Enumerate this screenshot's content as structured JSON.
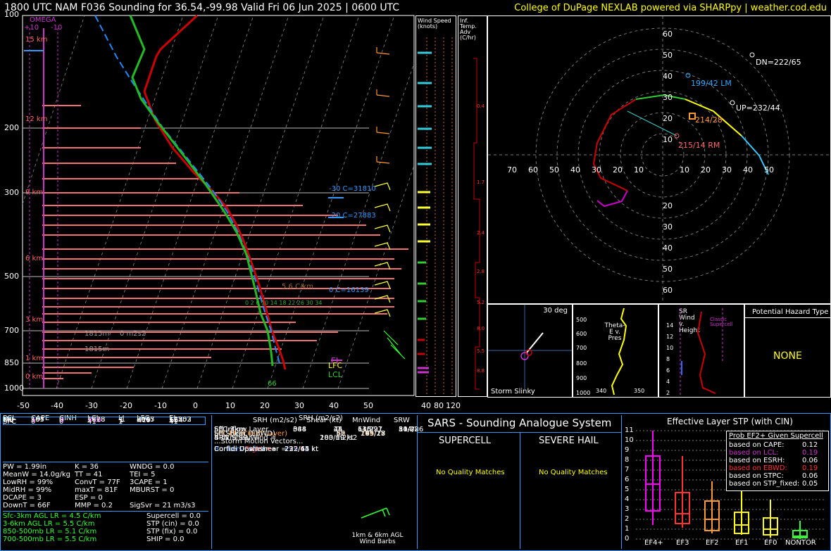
{
  "header": {
    "title": "1800 UTC NAM F036 Sounding for 36.54,-99.98 Valid  Fri 06 Jun 2025 | 0600 UTC",
    "credit": "College of DuPage NEXLAB powered via SHARPpy | weather.cod.edu"
  },
  "skewt": {
    "pressure_labels": [
      "100",
      "200",
      "300",
      "500",
      "700",
      "850",
      "1000"
    ],
    "temp_labels": [
      "-50",
      "-40",
      "-30",
      "-20",
      "-10",
      "0",
      "10",
      "20",
      "30",
      "40",
      "50"
    ],
    "height_labels": [
      "15 km",
      "12 km",
      "9 km",
      "6 km",
      "3 km",
      "1 km",
      "0 km"
    ],
    "omega_title": "OMEGA",
    "omega_left": "+10",
    "omega_right": "-10",
    "isotherm_labels": [
      "-30 C=31810",
      "-20 C=27883",
      "0 C=16139"
    ],
    "lapse_label": "5.6 C/km",
    "pw_scale": "0 2 6 10   14  18 22 26 30 34",
    "dcape_a": "1815m",
    "dcape_b": "0 m2s2",
    "dcape_c": "1815m",
    "parcel_labels": {
      "el": "EL",
      "lfc": "LFC",
      "lcl": "LCL"
    },
    "sfc_theta": "66",
    "colors": {
      "temp": "#cc0000",
      "dew": "#22aa22",
      "wetbulb": "#2288ff",
      "virtual": "#cc0000"
    }
  },
  "wind_panel": {
    "title": "Wind Speed (knots)",
    "scale": [
      "40",
      "80",
      "120"
    ]
  },
  "infl_panel": {
    "title": "Inf. Temp. Adv (C/hr)",
    "values": [
      "0.4",
      "1.7",
      "2.4",
      "2.8",
      "5.2",
      "8.0",
      "5.5",
      "8.8"
    ]
  },
  "hodograph": {
    "ring_labels_top": [
      "60",
      "50",
      "40",
      "30",
      "20",
      "10"
    ],
    "ring_labels_bottom": [
      "20",
      "30",
      "40",
      "50",
      "60"
    ],
    "x_left": [
      "70",
      "60",
      "50",
      "40",
      "30",
      "20",
      "10"
    ],
    "x_right": [
      "10",
      "20",
      "30",
      "40",
      "50"
    ],
    "annot": {
      "dn": "DN=222/65",
      "lm": "199/42 LM",
      "up": "UP=232/44",
      "mean": "214/28",
      "rm": "215/14 RM"
    }
  },
  "storm_slinky": {
    "title": "Storm Slinky",
    "deg": "30 deg"
  },
  "theta_panel": {
    "levels": [
      "500",
      "600",
      "700",
      "800",
      "900",
      "1000"
    ],
    "label": "Theta-E v. Pres",
    "x1": "340",
    "x2": "350"
  },
  "srwind_panel": {
    "title": "SR Wind v. Height",
    "levels": [
      "14",
      "12",
      "10",
      "8",
      "6",
      "4",
      "2"
    ],
    "note": "Classic Supercell"
  },
  "hazard": {
    "title": "Potential Hazard Type",
    "value": "NONE"
  },
  "parcel_table": {
    "headers": [
      "PCL",
      "CAPE",
      "CINH",
      "LCL",
      "LI",
      "LFC",
      "EL"
    ],
    "rows": [
      [
        "SFC",
        "0",
        "0",
        "41",
        "1",
        "--",
        "41"
      ],
      [
        "EFF",
        "197",
        "0",
        "1818",
        "-1",
        "8615",
        "12553"
      ],
      [
        "ML",
        "1",
        "0",
        "419",
        "1",
        "419",
        "654"
      ],
      [
        "MU",
        "165",
        "0",
        "1828",
        "-1",
        "8967",
        "12202"
      ]
    ]
  },
  "indices": {
    "col1": [
      "PW = 1.99in",
      "MeanW = 14.0g/kg",
      "LowRH = 99%",
      "MidRH = 99%",
      "DCAPE = 3",
      "DownT = 66F"
    ],
    "col2": [
      "K = 36",
      "TT = 41",
      "ConvT = 77F",
      "maxT = 81F",
      "ESP = 0",
      "MMP = 0.2"
    ],
    "col3": [
      "WNDG = 0.0",
      "TEI = 5",
      "3CAPE = 1",
      "MBURST = 0",
      "",
      "SigSvr = 21 m3/s3"
    ]
  },
  "lapse": {
    "lines": [
      "Sfc-3km AGL LR = 4.5 C/km",
      "3-6km AGL LR = 5.5 C/km",
      "850-500mb LR = 5.1 C/km",
      "700-500mb LR = 5.5 C/km"
    ],
    "comp": [
      "Supercell = 0.0",
      "STP (cin) = 0.0",
      "STP (fix) = 0.0",
      "SHIP = 0.0"
    ]
  },
  "kin_table": {
    "headers": [
      "SRH (m2/s2)",
      "Shear (kt)",
      "MnWind",
      "SRW"
    ],
    "rows": [
      [
        "SFC-1km",
        "344",
        "24",
        "63/29",
        "54/42"
      ],
      [
        "SFC-3km",
        "588",
        "45",
        "110/21",
        "80/28"
      ],
      [
        "Eff Inflow Layer",
        "0",
        "0",
        "145/27",
        "114/26"
      ],
      [
        "SFC-6km",
        "55",
        "149/17",
        "99/17",
        ""
      ],
      [
        "SFC-8km",
        "60",
        "165/15",
        "105/12",
        ""
      ],
      [
        "LCL-EL (Cloud Layer)",
        "73",
        "214/28",
        "213/14",
        ""
      ],
      [
        "Eff Shear (EBWD)",
        "52",
        "195/28",
        "177/16",
        ""
      ]
    ],
    "brn": [
      "BRN Shear =",
      "183 m2/s2"
    ],
    "sr46": [
      "4-6km SR Wind =",
      "200/19 kt"
    ],
    "motion_title": "...Storm Motion Vectors...",
    "motion": [
      [
        "Bunkers Right =",
        "215/14 kt"
      ],
      [
        "Bunkers Left =",
        "199/42 kt"
      ],
      [
        "Corfidi Downshear =",
        "222/65 kt"
      ],
      [
        "Corfidi Upshear =",
        "232/44 kt"
      ]
    ],
    "barb_label": "1km & 6km AGL Wind Barbs"
  },
  "sars": {
    "title": "SARS - Sounding Analogue System",
    "supercell": "SUPERCELL",
    "hail": "SEVERE HAIL",
    "supercell_match": "No Quality Matches",
    "hail_match": "No Quality Matches"
  },
  "stp": {
    "title": "Effective Layer STP (with CIN)",
    "y_ticks": [
      "11",
      "10",
      "9",
      "8",
      "7",
      "6",
      "5",
      "4",
      "3",
      "2",
      "1",
      "0"
    ],
    "categories": [
      "EF4+",
      "EF3",
      "EF2",
      "EF1",
      "EF0",
      "NONTOR"
    ],
    "prob_title": "Prob EF2+ Given Supercell",
    "prob": [
      [
        "based on CAPE:",
        "0.12"
      ],
      [
        "based on LCL:",
        "0.19"
      ],
      [
        "based on ESRH:",
        "0.06"
      ],
      [
        "based on EBWD:",
        "0.19"
      ],
      [
        "based on STPC:",
        "0.06"
      ],
      [
        "based on STP_fixed:",
        "0.05"
      ]
    ]
  }
}
